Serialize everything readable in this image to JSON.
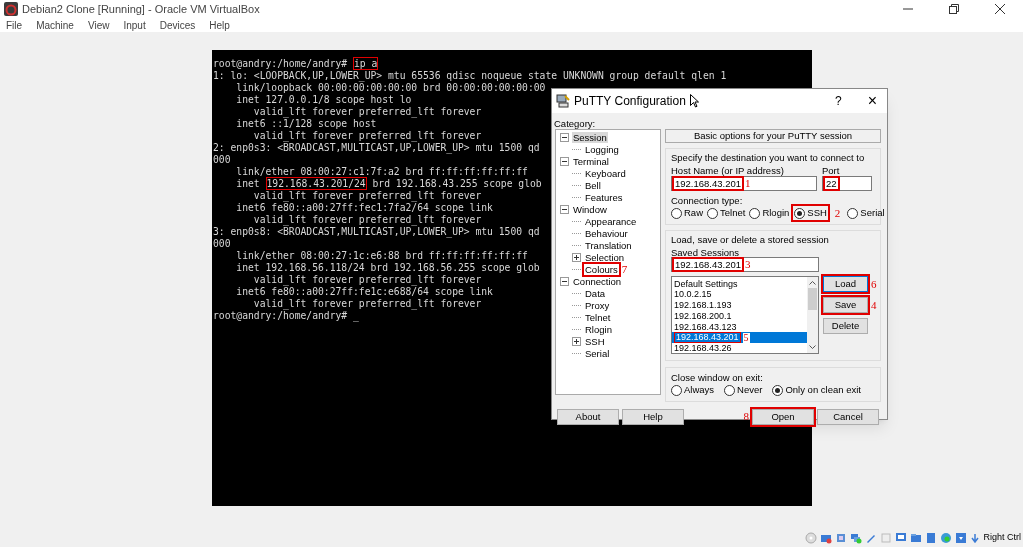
{
  "window": {
    "title": "Debian2 Clone [Running] - Oracle VM VirtualBox"
  },
  "menu": [
    "File",
    "Machine",
    "View",
    "Input",
    "Devices",
    "Help"
  ],
  "terminal": {
    "lines": [
      [
        {
          "text": "root@andry:/home/andry# ",
          "boxed": false
        },
        {
          "text": "ip a",
          "boxed": true
        }
      ],
      [
        {
          "text": "1: lo: <LOOPBACK,UP,LOWER_UP> mtu 65536 qdisc noqueue state UNKNOWN group default qlen 1",
          "boxed": false
        }
      ],
      [
        {
          "text": "    link/loopback 00:00:00:00:00:00 brd 00:00:00:00:00:00",
          "boxed": false
        }
      ],
      [
        {
          "text": "    inet 127.0.0.1/8 scope host lo",
          "boxed": false
        }
      ],
      [
        {
          "text": "       valid_lft forever preferred_lft forever",
          "boxed": false
        }
      ],
      [
        {
          "text": "    inet6 ::1/128 scope host",
          "boxed": false
        }
      ],
      [
        {
          "text": "       valid_lft forever preferred_lft forever",
          "boxed": false
        }
      ],
      [
        {
          "text": "2: enp0s3: <BROADCAST,MULTICAST,UP,LOWER_UP> mtu 1500 qd",
          "boxed": false
        }
      ],
      [
        {
          "text": "000",
          "boxed": false
        }
      ],
      [
        {
          "text": "    link/ether 08:00:27:c1:7f:a2 brd ff:ff:ff:ff:ff:ff",
          "boxed": false
        }
      ],
      [
        {
          "text": "    inet ",
          "boxed": false
        },
        {
          "text": "192.168.43.201/24",
          "boxed": true
        },
        {
          "text": " brd 192.168.43.255 scope glob",
          "boxed": false
        }
      ],
      [
        {
          "text": "       valid_lft forever preferred_lft forever",
          "boxed": false
        }
      ],
      [
        {
          "text": "    inet6 fe80::a00:27ff:fec1:7fa2/64 scope link",
          "boxed": false
        }
      ],
      [
        {
          "text": "       valid_lft forever preferred_lft forever",
          "boxed": false
        }
      ],
      [
        {
          "text": "3: enp0s8: <BROADCAST,MULTICAST,UP,LOWER_UP> mtu 1500 qd",
          "boxed": false
        }
      ],
      [
        {
          "text": "000",
          "boxed": false
        }
      ],
      [
        {
          "text": "    link/ether 08:00:27:1c:e6:88 brd ff:ff:ff:ff:ff:ff",
          "boxed": false
        }
      ],
      [
        {
          "text": "    inet 192.168.56.118/24 brd 192.168.56.255 scope glob",
          "boxed": false
        }
      ],
      [
        {
          "text": "       valid_lft forever preferred_lft forever",
          "boxed": false
        }
      ],
      [
        {
          "text": "    inet6 fe80::a00:27ff:fe1c:e688/64 scope link",
          "boxed": false
        }
      ],
      [
        {
          "text": "       valid_lft forever preferred_lft forever",
          "boxed": false
        }
      ],
      [
        {
          "text": "root@andry:/home/andry# _",
          "boxed": false
        }
      ]
    ]
  },
  "dialog": {
    "title": "PuTTY Configuration",
    "help_button": "?",
    "close_button": "×",
    "category_label": "Category:",
    "tree": [
      {
        "label": "Session",
        "selected": true,
        "boxed": false,
        "expanded": true,
        "children": [
          {
            "label": "Logging",
            "selected": false,
            "boxed": false
          }
        ]
      },
      {
        "label": "Terminal",
        "selected": false,
        "boxed": false,
        "expanded": true,
        "children": [
          {
            "label": "Keyboard",
            "selected": false,
            "boxed": false
          },
          {
            "label": "Bell",
            "selected": false,
            "boxed": false
          },
          {
            "label": "Features",
            "selected": false,
            "boxed": false
          }
        ]
      },
      {
        "label": "Window",
        "selected": false,
        "boxed": false,
        "expanded": true,
        "children": [
          {
            "label": "Appearance",
            "selected": false,
            "boxed": false
          },
          {
            "label": "Behaviour",
            "selected": false,
            "boxed": false
          },
          {
            "label": "Translation",
            "selected": false,
            "boxed": false
          },
          {
            "label": "Selection",
            "selected": false,
            "boxed": false,
            "expanded": false
          },
          {
            "label": "Colours",
            "selected": false,
            "boxed": true,
            "annotation": "7"
          }
        ]
      },
      {
        "label": "Connection",
        "selected": false,
        "boxed": false,
        "expanded": true,
        "children": [
          {
            "label": "Data",
            "selected": false,
            "boxed": false
          },
          {
            "label": "Proxy",
            "selected": false,
            "boxed": false
          },
          {
            "label": "Telnet",
            "selected": false,
            "boxed": false
          },
          {
            "label": "Rlogin",
            "selected": false,
            "boxed": false
          },
          {
            "label": "SSH",
            "selected": false,
            "boxed": false,
            "expanded": false
          },
          {
            "label": "Serial",
            "selected": false,
            "boxed": false
          }
        ]
      }
    ],
    "panel_header": "Basic options for your PuTTY session",
    "destination_group": "Specify the destination you want to connect to",
    "host_label": "Host Name (or IP address)",
    "host": {
      "value": "192.168.43.201",
      "boxed": true,
      "annotation": "1"
    },
    "port_label": "Port",
    "port": {
      "value": "22",
      "boxed": true
    },
    "connection_type_label": "Connection type:",
    "connection_types": [
      {
        "label": "Raw",
        "selected": false,
        "boxed": false
      },
      {
        "label": "Telnet",
        "selected": false,
        "boxed": false
      },
      {
        "label": "Rlogin",
        "selected": false,
        "boxed": false
      },
      {
        "label": "SSH",
        "selected": true,
        "boxed": true,
        "annotation": "2"
      },
      {
        "label": "Serial",
        "selected": false,
        "boxed": false
      }
    ],
    "sessions_group": "Load, save or delete a stored session",
    "saved_sessions_label": "Saved Sessions",
    "saved_session": {
      "value": "192.168.43.201",
      "boxed": true,
      "annotation": "3"
    },
    "sessions": [
      {
        "label": "Default Settings",
        "selected": false,
        "boxed": false
      },
      {
        "label": "10.0.2.15",
        "selected": false,
        "boxed": false
      },
      {
        "label": "192.168.1.193",
        "selected": false,
        "boxed": false
      },
      {
        "label": "192.168.200.1",
        "selected": false,
        "boxed": false
      },
      {
        "label": "192.168.43.123",
        "selected": false,
        "boxed": false
      },
      {
        "label": "192.168.43.201",
        "selected": true,
        "boxed": true,
        "annotation": "5"
      },
      {
        "label": "192.168.43.26",
        "selected": false,
        "boxed": false
      }
    ],
    "session_buttons": [
      {
        "label": "Load",
        "boxed": true,
        "focused": true,
        "annotation": "6"
      },
      {
        "label": "Save",
        "boxed": true,
        "focused": false,
        "annotation": "4"
      },
      {
        "label": "Delete",
        "boxed": false,
        "focused": false
      }
    ],
    "close_label": "Close window on exit:",
    "close_options": [
      {
        "label": "Always",
        "selected": false
      },
      {
        "label": "Never",
        "selected": false
      },
      {
        "label": "Only on clean exit",
        "selected": true
      }
    ],
    "footer_buttons": [
      {
        "label": "About",
        "boxed": false
      },
      {
        "label": "Help",
        "boxed": false
      },
      {
        "label": "Open",
        "boxed": true,
        "annotation": "8"
      },
      {
        "label": "Cancel",
        "boxed": false
      }
    ]
  },
  "status_bar": {
    "host_key": "Right Ctrl"
  }
}
